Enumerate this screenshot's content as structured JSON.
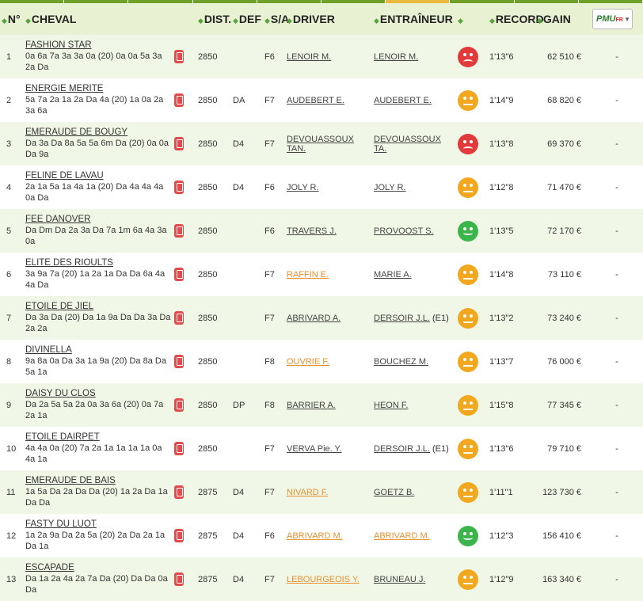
{
  "header": {
    "num": "N°",
    "cheval": "CHEVAL",
    "dist": "DIST.",
    "def": "DEF",
    "sa": "S/A",
    "driver": "DRIVER",
    "entraineur": "ENTRAÎNEUR",
    "record": "RECORD",
    "gain": "GAIN",
    "pmu_logo": "PMU",
    "pmu_fr": "FR"
  },
  "icons": {
    "sort": "sort-arrows-icon",
    "phone": "mobile-phone-icon",
    "chevron": "chevron-down-icon"
  },
  "colors": {
    "green": "#3bb549",
    "orange": "#f2a81e",
    "red": "#e23a3a",
    "link_orange": "#e8902e"
  },
  "rows": [
    {
      "num": "1",
      "name": "FASHION STAR",
      "musique": "0a 6a 7a 3a 3a 0a (20) 0a 0a 5a 3a 2a Da",
      "dist": "2850",
      "def": "",
      "sa": "F6",
      "driver": "LENOIR M.",
      "driver_orange": false,
      "trainer": "LENOIR M.",
      "trainer_orange": false,
      "trainer_extra": "",
      "mood": "red",
      "record": "1'13\"6",
      "gain": "62 510 €",
      "cote": "-"
    },
    {
      "num": "2",
      "name": "ENERGIE MERITE",
      "musique": "5a 7a 2a 1a 2a Da 4a (20) 1a 0a 2a 3a 6a",
      "dist": "2850",
      "def": "DA",
      "sa": "F7",
      "driver": "AUDEBERT E.",
      "driver_orange": false,
      "trainer": "AUDEBERT E.",
      "trainer_orange": false,
      "trainer_extra": "",
      "mood": "orange",
      "record": "1'14\"9",
      "gain": "68 820 €",
      "cote": "-"
    },
    {
      "num": "3",
      "name": "EMERAUDE DE BOUGY",
      "musique": "Da 3a Da 8a 5a 5a 6m Da (20) 0a 0a Da 9a",
      "dist": "2850",
      "def": "D4",
      "sa": "F7",
      "driver": "DEVOUASSOUX TAN.",
      "driver_orange": false,
      "trainer": "DEVOUASSOUX TA.",
      "trainer_orange": false,
      "trainer_extra": "",
      "mood": "red",
      "record": "1'13\"8",
      "gain": "69 370 €",
      "cote": "-"
    },
    {
      "num": "4",
      "name": "FELINE DE LAVAU",
      "musique": "2a 1a 5a 1a 4a 1a (20) Da 4a 4a 4a 0a Da",
      "dist": "2850",
      "def": "D4",
      "sa": "F6",
      "driver": "JOLY R.",
      "driver_orange": false,
      "trainer": "JOLY R.",
      "trainer_orange": false,
      "trainer_extra": "",
      "mood": "orange",
      "record": "1'12\"8",
      "gain": "71 470 €",
      "cote": "-"
    },
    {
      "num": "5",
      "name": "FEE DANOVER",
      "musique": "Da Dm Da 2a 3a Da 7a 1m 6a 4a 3a 0a",
      "dist": "2850",
      "def": "",
      "sa": "F6",
      "driver": "TRAVERS J.",
      "driver_orange": false,
      "trainer": "PROVOOST S.",
      "trainer_orange": false,
      "trainer_extra": "",
      "mood": "green",
      "record": "1'13\"5",
      "gain": "72 170 €",
      "cote": "-"
    },
    {
      "num": "6",
      "name": "ELITE DES RIOULTS",
      "musique": "3a 9a 7a (20) 1a 2a 1a Da Da 6a 4a 4a Da",
      "dist": "2850",
      "def": "",
      "sa": "F7",
      "driver": "RAFFIN E.",
      "driver_orange": true,
      "trainer": "MARIE A.",
      "trainer_orange": false,
      "trainer_extra": "",
      "mood": "orange",
      "record": "1'14\"8",
      "gain": "73 110 €",
      "cote": "-"
    },
    {
      "num": "7",
      "name": "ETOILE DE JIEL",
      "musique": "Da 3a Da (20) Da 1a 9a Da Da 3a Da 2a 2a",
      "dist": "2850",
      "def": "",
      "sa": "F7",
      "driver": "ABRIVARD A.",
      "driver_orange": false,
      "trainer": "DERSOIR J.L.",
      "trainer_orange": false,
      "trainer_extra": " (E1)",
      "mood": "orange",
      "record": "1'13\"2",
      "gain": "73 240 €",
      "cote": "-"
    },
    {
      "num": "8",
      "name": "DIVINELLA",
      "musique": "9a 8a 0a Da 3a 1a 9a (20) Da 8a Da 5a 1a",
      "dist": "2850",
      "def": "",
      "sa": "F8",
      "driver": "OUVRIE F.",
      "driver_orange": true,
      "trainer": "BOUCHEZ M.",
      "trainer_orange": false,
      "trainer_extra": "",
      "mood": "orange",
      "record": "1'13\"7",
      "gain": "76 000 €",
      "cote": "-"
    },
    {
      "num": "9",
      "name": "DAISY DU CLOS",
      "musique": "Da 2a 5a 5a 2a 0a 3a 6a (20) 0a 7a 2a 1a",
      "dist": "2850",
      "def": "DP",
      "sa": "F8",
      "driver": "BARRIER A.",
      "driver_orange": false,
      "trainer": "HEON F.",
      "trainer_orange": false,
      "trainer_extra": "",
      "mood": "orange",
      "record": "1'15\"8",
      "gain": "77 345 €",
      "cote": "-"
    },
    {
      "num": "10",
      "name": "ETOILE DAIRPET",
      "musique": "4a 4a 0a (20) 7a 2a 1a 1a 1a 1a 0a 4a 1a",
      "dist": "2850",
      "def": "",
      "sa": "F7",
      "driver": "VERVA Pie. Y.",
      "driver_orange": false,
      "trainer": "DERSOIR J.L.",
      "trainer_orange": false,
      "trainer_extra": " (E1)",
      "mood": "orange",
      "record": "1'13\"6",
      "gain": "79 710 €",
      "cote": "-"
    },
    {
      "num": "11",
      "name": "EMERAUDE DE BAIS",
      "musique": "1a 5a Da 2a Da Da (20) 1a 2a Da 1a Da Da",
      "dist": "2875",
      "def": "D4",
      "sa": "F7",
      "driver": "NIVARD F.",
      "driver_orange": true,
      "trainer": "GOETZ B.",
      "trainer_orange": false,
      "trainer_extra": "",
      "mood": "orange",
      "record": "1'11\"1",
      "gain": "123 730 €",
      "cote": "-"
    },
    {
      "num": "12",
      "name": "FASTY DU LUOT",
      "musique": "1a 2a 9a Da 2a 5a (20) 2a Da 2a 1a Da 1a",
      "dist": "2875",
      "def": "D4",
      "sa": "F6",
      "driver": "ABRIVARD M.",
      "driver_orange": true,
      "trainer": "ABRIVARD M.",
      "trainer_orange": true,
      "trainer_extra": "",
      "mood": "green",
      "record": "1'12\"3",
      "gain": "156 410 €",
      "cote": "-"
    },
    {
      "num": "13",
      "name": "ESCAPADE",
      "musique": "Da 1a 2a 4a 2a 7a Da (20) Da Da 0a Da",
      "dist": "2875",
      "def": "D4",
      "sa": "F7",
      "driver": "LEBOURGEOIS Y.",
      "driver_orange": true,
      "trainer": "BRUNEAU J.",
      "trainer_orange": false,
      "trainer_extra": "",
      "mood": "orange",
      "record": "1'12\"9",
      "gain": "163 340 €",
      "cote": "-"
    }
  ]
}
